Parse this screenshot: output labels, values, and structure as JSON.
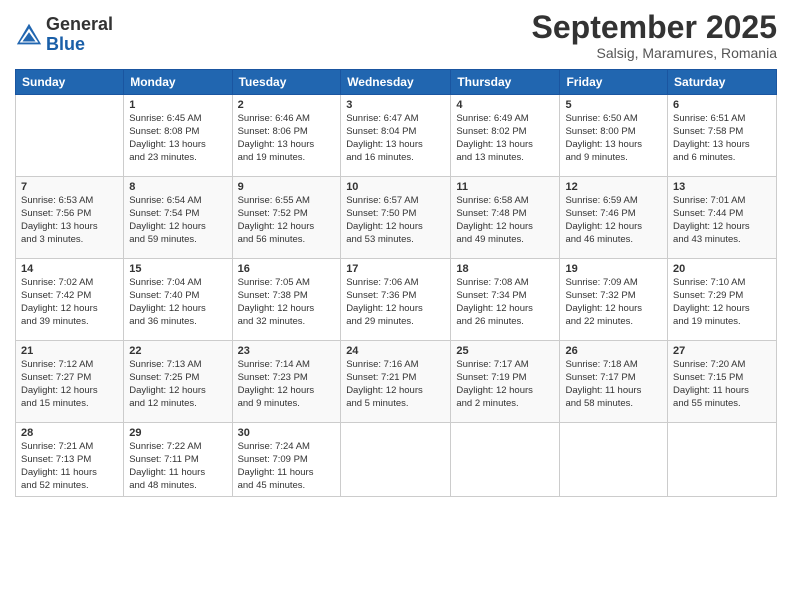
{
  "header": {
    "logo_line1": "General",
    "logo_line2": "Blue",
    "month": "September 2025",
    "location": "Salsig, Maramures, Romania"
  },
  "weekdays": [
    "Sunday",
    "Monday",
    "Tuesday",
    "Wednesday",
    "Thursday",
    "Friday",
    "Saturday"
  ],
  "weeks": [
    [
      {
        "day": "",
        "info": ""
      },
      {
        "day": "1",
        "info": "Sunrise: 6:45 AM\nSunset: 8:08 PM\nDaylight: 13 hours\nand 23 minutes."
      },
      {
        "day": "2",
        "info": "Sunrise: 6:46 AM\nSunset: 8:06 PM\nDaylight: 13 hours\nand 19 minutes."
      },
      {
        "day": "3",
        "info": "Sunrise: 6:47 AM\nSunset: 8:04 PM\nDaylight: 13 hours\nand 16 minutes."
      },
      {
        "day": "4",
        "info": "Sunrise: 6:49 AM\nSunset: 8:02 PM\nDaylight: 13 hours\nand 13 minutes."
      },
      {
        "day": "5",
        "info": "Sunrise: 6:50 AM\nSunset: 8:00 PM\nDaylight: 13 hours\nand 9 minutes."
      },
      {
        "day": "6",
        "info": "Sunrise: 6:51 AM\nSunset: 7:58 PM\nDaylight: 13 hours\nand 6 minutes."
      }
    ],
    [
      {
        "day": "7",
        "info": "Sunrise: 6:53 AM\nSunset: 7:56 PM\nDaylight: 13 hours\nand 3 minutes."
      },
      {
        "day": "8",
        "info": "Sunrise: 6:54 AM\nSunset: 7:54 PM\nDaylight: 12 hours\nand 59 minutes."
      },
      {
        "day": "9",
        "info": "Sunrise: 6:55 AM\nSunset: 7:52 PM\nDaylight: 12 hours\nand 56 minutes."
      },
      {
        "day": "10",
        "info": "Sunrise: 6:57 AM\nSunset: 7:50 PM\nDaylight: 12 hours\nand 53 minutes."
      },
      {
        "day": "11",
        "info": "Sunrise: 6:58 AM\nSunset: 7:48 PM\nDaylight: 12 hours\nand 49 minutes."
      },
      {
        "day": "12",
        "info": "Sunrise: 6:59 AM\nSunset: 7:46 PM\nDaylight: 12 hours\nand 46 minutes."
      },
      {
        "day": "13",
        "info": "Sunrise: 7:01 AM\nSunset: 7:44 PM\nDaylight: 12 hours\nand 43 minutes."
      }
    ],
    [
      {
        "day": "14",
        "info": "Sunrise: 7:02 AM\nSunset: 7:42 PM\nDaylight: 12 hours\nand 39 minutes."
      },
      {
        "day": "15",
        "info": "Sunrise: 7:04 AM\nSunset: 7:40 PM\nDaylight: 12 hours\nand 36 minutes."
      },
      {
        "day": "16",
        "info": "Sunrise: 7:05 AM\nSunset: 7:38 PM\nDaylight: 12 hours\nand 32 minutes."
      },
      {
        "day": "17",
        "info": "Sunrise: 7:06 AM\nSunset: 7:36 PM\nDaylight: 12 hours\nand 29 minutes."
      },
      {
        "day": "18",
        "info": "Sunrise: 7:08 AM\nSunset: 7:34 PM\nDaylight: 12 hours\nand 26 minutes."
      },
      {
        "day": "19",
        "info": "Sunrise: 7:09 AM\nSunset: 7:32 PM\nDaylight: 12 hours\nand 22 minutes."
      },
      {
        "day": "20",
        "info": "Sunrise: 7:10 AM\nSunset: 7:29 PM\nDaylight: 12 hours\nand 19 minutes."
      }
    ],
    [
      {
        "day": "21",
        "info": "Sunrise: 7:12 AM\nSunset: 7:27 PM\nDaylight: 12 hours\nand 15 minutes."
      },
      {
        "day": "22",
        "info": "Sunrise: 7:13 AM\nSunset: 7:25 PM\nDaylight: 12 hours\nand 12 minutes."
      },
      {
        "day": "23",
        "info": "Sunrise: 7:14 AM\nSunset: 7:23 PM\nDaylight: 12 hours\nand 9 minutes."
      },
      {
        "day": "24",
        "info": "Sunrise: 7:16 AM\nSunset: 7:21 PM\nDaylight: 12 hours\nand 5 minutes."
      },
      {
        "day": "25",
        "info": "Sunrise: 7:17 AM\nSunset: 7:19 PM\nDaylight: 12 hours\nand 2 minutes."
      },
      {
        "day": "26",
        "info": "Sunrise: 7:18 AM\nSunset: 7:17 PM\nDaylight: 11 hours\nand 58 minutes."
      },
      {
        "day": "27",
        "info": "Sunrise: 7:20 AM\nSunset: 7:15 PM\nDaylight: 11 hours\nand 55 minutes."
      }
    ],
    [
      {
        "day": "28",
        "info": "Sunrise: 7:21 AM\nSunset: 7:13 PM\nDaylight: 11 hours\nand 52 minutes."
      },
      {
        "day": "29",
        "info": "Sunrise: 7:22 AM\nSunset: 7:11 PM\nDaylight: 11 hours\nand 48 minutes."
      },
      {
        "day": "30",
        "info": "Sunrise: 7:24 AM\nSunset: 7:09 PM\nDaylight: 11 hours\nand 45 minutes."
      },
      {
        "day": "",
        "info": ""
      },
      {
        "day": "",
        "info": ""
      },
      {
        "day": "",
        "info": ""
      },
      {
        "day": "",
        "info": ""
      }
    ]
  ]
}
